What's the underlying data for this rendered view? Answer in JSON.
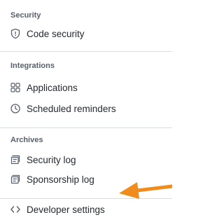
{
  "sections": [
    {
      "title": "Security",
      "items": [
        {
          "label": "Code security",
          "icon": "shield-icon"
        }
      ]
    },
    {
      "title": "Integrations",
      "items": [
        {
          "label": "Applications",
          "icon": "apps-grid-icon"
        },
        {
          "label": "Scheduled reminders",
          "icon": "clock-icon"
        }
      ]
    },
    {
      "title": "Archives",
      "items": [
        {
          "label": "Security log",
          "icon": "log-icon"
        },
        {
          "label": "Sponsorship log",
          "icon": "log-icon"
        }
      ]
    }
  ],
  "developer": {
    "label": "Developer settings",
    "icon": "code-icon"
  },
  "colors": {
    "text": "#24292f",
    "muted": "#57606a",
    "icon": "#57606a",
    "divider": "#d8dee4",
    "arrow": "#f08c1e"
  }
}
